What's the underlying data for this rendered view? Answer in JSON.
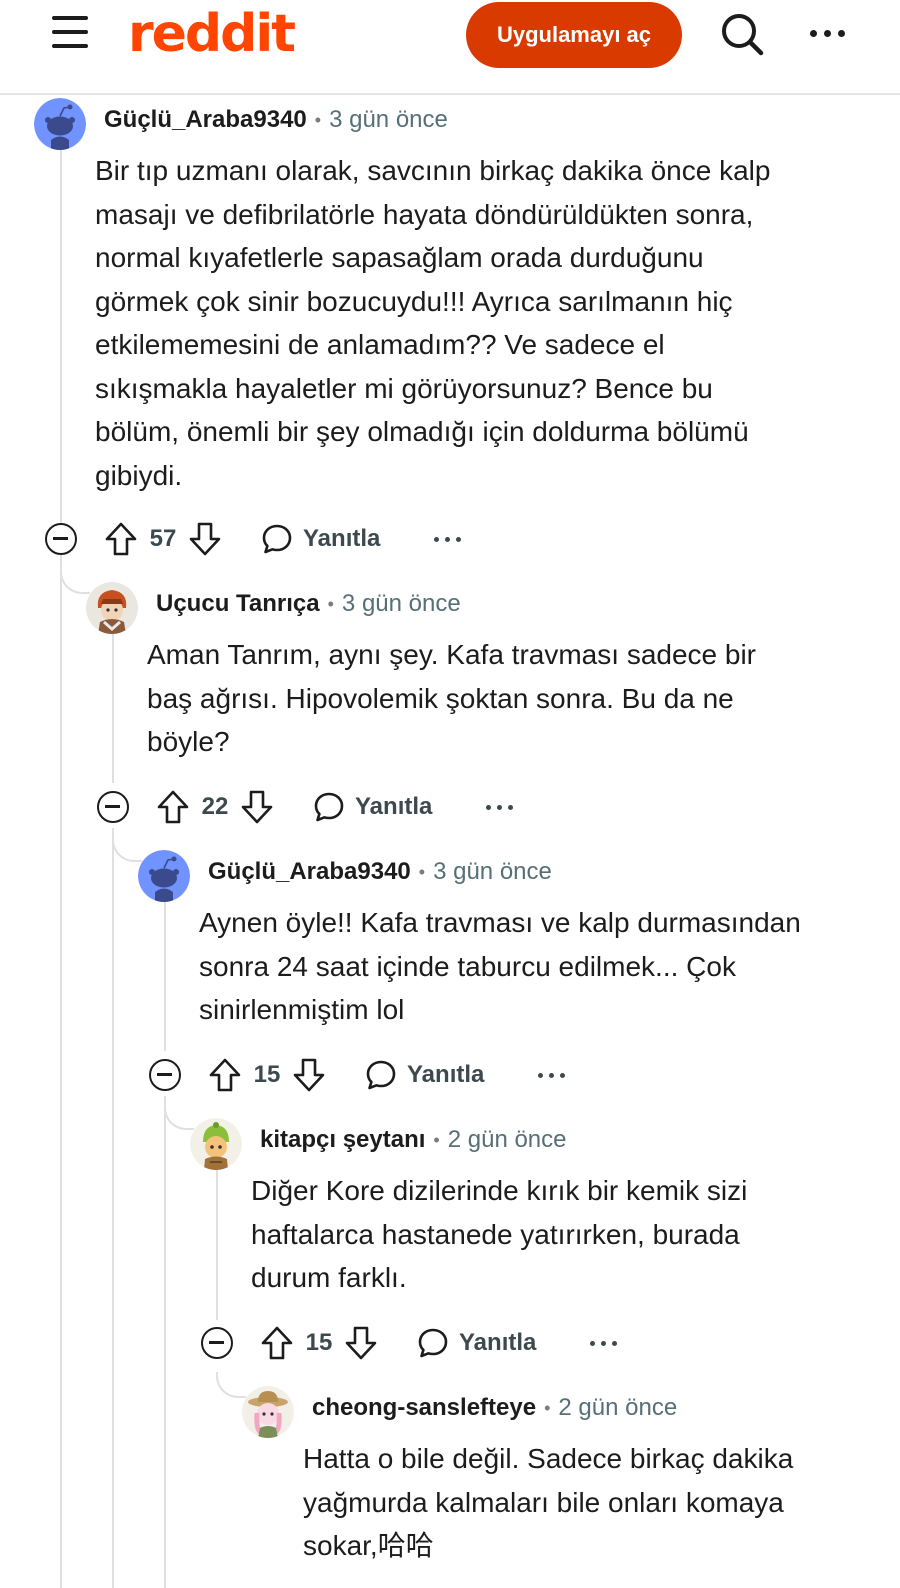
{
  "header": {
    "logo": "reddit",
    "open_app": "Uygulamayı aç",
    "icons": [
      "menu-icon",
      "search-icon",
      "more-icon"
    ],
    "accent": "#ff4500"
  },
  "comments": [
    {
      "username": "Güçlü_Araba9340",
      "separator": "•",
      "time": "3 gün önce",
      "avatar": "snoo-avatar-blue",
      "body": [
        "Bir tıp uzmanı olarak, savcının birkaç dakika önce kalp",
        "masajı ve defibrilatörle hayata döndürüldükten sonra,",
        "normal kıyafetlerle sapasağlam orada durduğunu",
        "görmek çok sinir bozucuydu!!! Ayrıca sarılmanın hiç",
        "etkilememesini de anlamadım?? Ve sadece el",
        "sıkışmakla hayaletler mi görüyorsunuz? Bence bu",
        "bölüm, önemli bir şey olmadığı için doldurma bölümü",
        "gibiydi."
      ],
      "score": "57",
      "reply": "Yanıtla"
    },
    {
      "username": "Uçucu Tanrıça",
      "separator": "•",
      "time": "3 gün önce",
      "avatar": "custom-avatar-orange",
      "body": [
        "Aman Tanrım, aynı şey. Kafa travması sadece bir",
        "baş ağrısı. Hipovolemik şoktan sonra. Bu da ne",
        "böyle?"
      ],
      "score": "22",
      "reply": "Yanıtla"
    },
    {
      "username": "Güçlü_Araba9340",
      "separator": "•",
      "time": "3 gün önce",
      "avatar": "snoo-avatar-blue",
      "body": [
        "Aynen öyle!! Kafa travması ve kalp durmasından",
        "sonra 24 saat içinde taburcu edilmek... Çok",
        "sinirlenmiştim lol"
      ],
      "score": "15",
      "reply": "Yanıtla"
    },
    {
      "username": "kitapçı şeytanı",
      "separator": "•",
      "time": "2 gün önce",
      "avatar": "custom-avatar-green-hat",
      "body": [
        "Diğer Kore dizilerinde kırık bir kemik sizi",
        "haftalarca hastanede yatırırken, burada",
        "durum farklı."
      ],
      "score": "15",
      "reply": "Yanıtla"
    },
    {
      "username": "cheong-sanslefteye",
      "separator": "•",
      "time": "2 gün önce",
      "avatar": "custom-avatar-pink-hat",
      "body": [
        "Hatta o bile değil. Sadece birkaç dakika",
        "yağmurda kalmaları bile onları komaya",
        "sokar,哈哈"
      ]
    }
  ]
}
